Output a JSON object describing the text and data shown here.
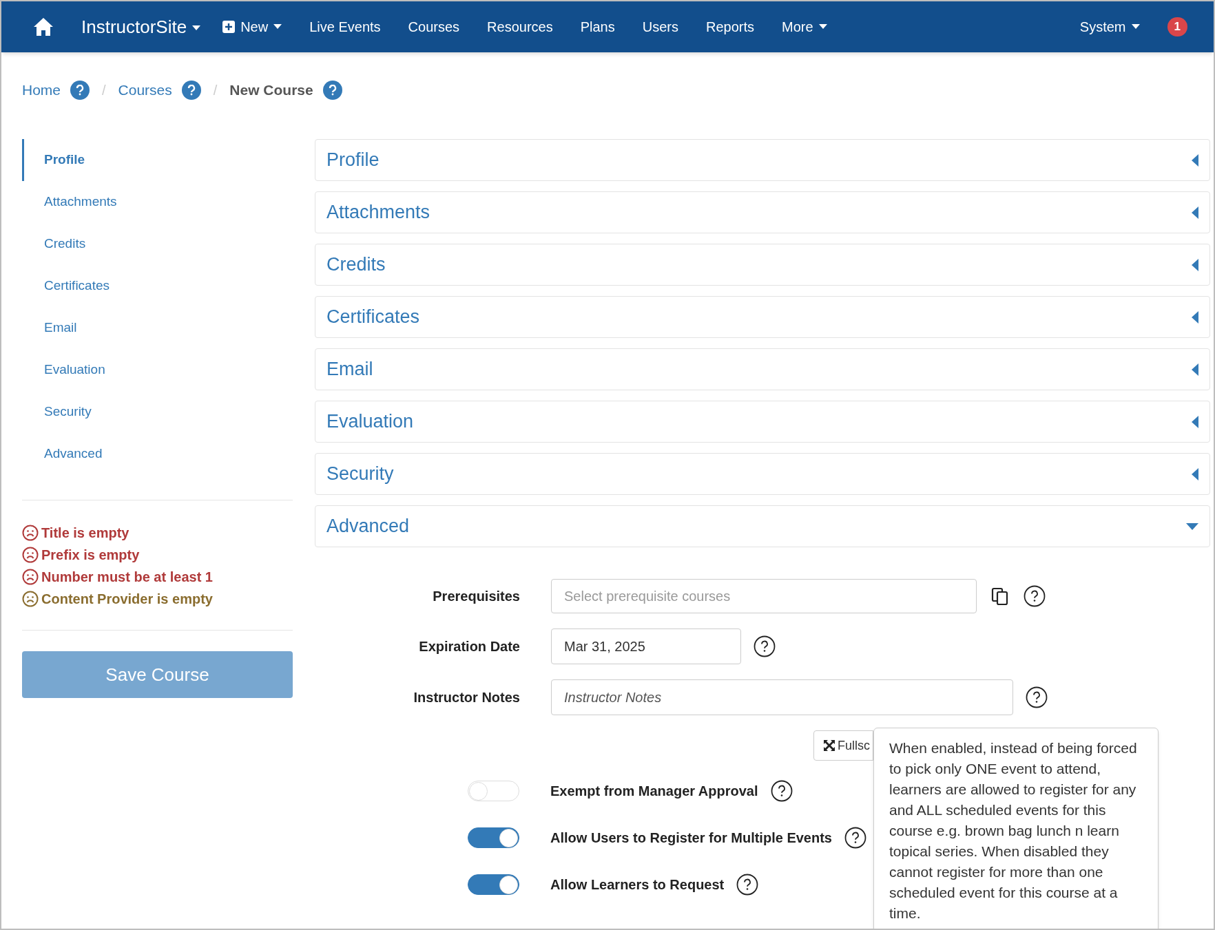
{
  "navbar": {
    "brand": "InstructorSite",
    "items": [
      {
        "label": "New",
        "kind": "new"
      },
      {
        "label": "Live Events",
        "kind": "link"
      },
      {
        "label": "Courses",
        "kind": "link"
      },
      {
        "label": "Resources",
        "kind": "link"
      },
      {
        "label": "Plans",
        "kind": "link"
      },
      {
        "label": "Users",
        "kind": "link"
      },
      {
        "label": "Reports",
        "kind": "link"
      },
      {
        "label": "More",
        "kind": "dropdown"
      }
    ],
    "system": "System",
    "notifications": "1"
  },
  "breadcrumb": [
    {
      "label": "Home",
      "current": false
    },
    {
      "separator": "/",
      "label": "Courses",
      "current": false
    },
    {
      "separator": "/",
      "label": "New Course",
      "current": true
    }
  ],
  "sidebar": {
    "items": [
      {
        "label": "Profile",
        "selected": true
      },
      {
        "label": "Attachments",
        "selected": false
      },
      {
        "label": "Credits",
        "selected": false
      },
      {
        "label": "Certificates",
        "selected": false
      },
      {
        "label": "Email",
        "selected": false
      },
      {
        "label": "Evaluation",
        "selected": false
      },
      {
        "label": "Security",
        "selected": false
      },
      {
        "label": "Advanced",
        "selected": false
      }
    ],
    "errors": [
      {
        "text": "Title is empty",
        "color": "#b03a3a"
      },
      {
        "text": "Prefix is empty",
        "color": "#b03a3a"
      },
      {
        "text": "Number must be at least 1",
        "color": "#b03a3a"
      },
      {
        "text": "Content Provider is empty",
        "color": "#8a6d2f"
      }
    ],
    "save_button": {
      "label": "Save Course",
      "disabled": true
    }
  },
  "sections": [
    {
      "title": "Profile",
      "expanded": false
    },
    {
      "title": "Attachments",
      "expanded": false
    },
    {
      "title": "Credits",
      "expanded": false
    },
    {
      "title": "Certificates",
      "expanded": false
    },
    {
      "title": "Email",
      "expanded": false
    },
    {
      "title": "Evaluation",
      "expanded": false
    },
    {
      "title": "Security",
      "expanded": false
    },
    {
      "title": "Advanced",
      "expanded": true
    }
  ],
  "fields": [
    {
      "label": "Prerequisites",
      "placeholder": "Select prerequisite courses",
      "kind": "multi"
    },
    {
      "label": "Expiration Date",
      "value": "Mar 31, 2025",
      "kind": "date"
    },
    {
      "label": "Instructor Notes",
      "placeholder": "Instructor Notes",
      "kind": "notes"
    }
  ],
  "fullscreen_button": "Fullsc",
  "toggles": [
    {
      "label": "Exempt from Manager Approval",
      "on": false
    },
    {
      "label": "Allow Users to Register for Multiple Events",
      "on": true
    },
    {
      "label": "Allow Learners to Request",
      "on": true
    }
  ],
  "tooltip": "When enabled, instead of being forced to pick only ONE event to attend, learners are allowed to register for any and ALL scheduled events for this course e.g. brown bag lunch n learn topical series. When disabled they cannot register for more than one scheduled event for this course at a time."
}
